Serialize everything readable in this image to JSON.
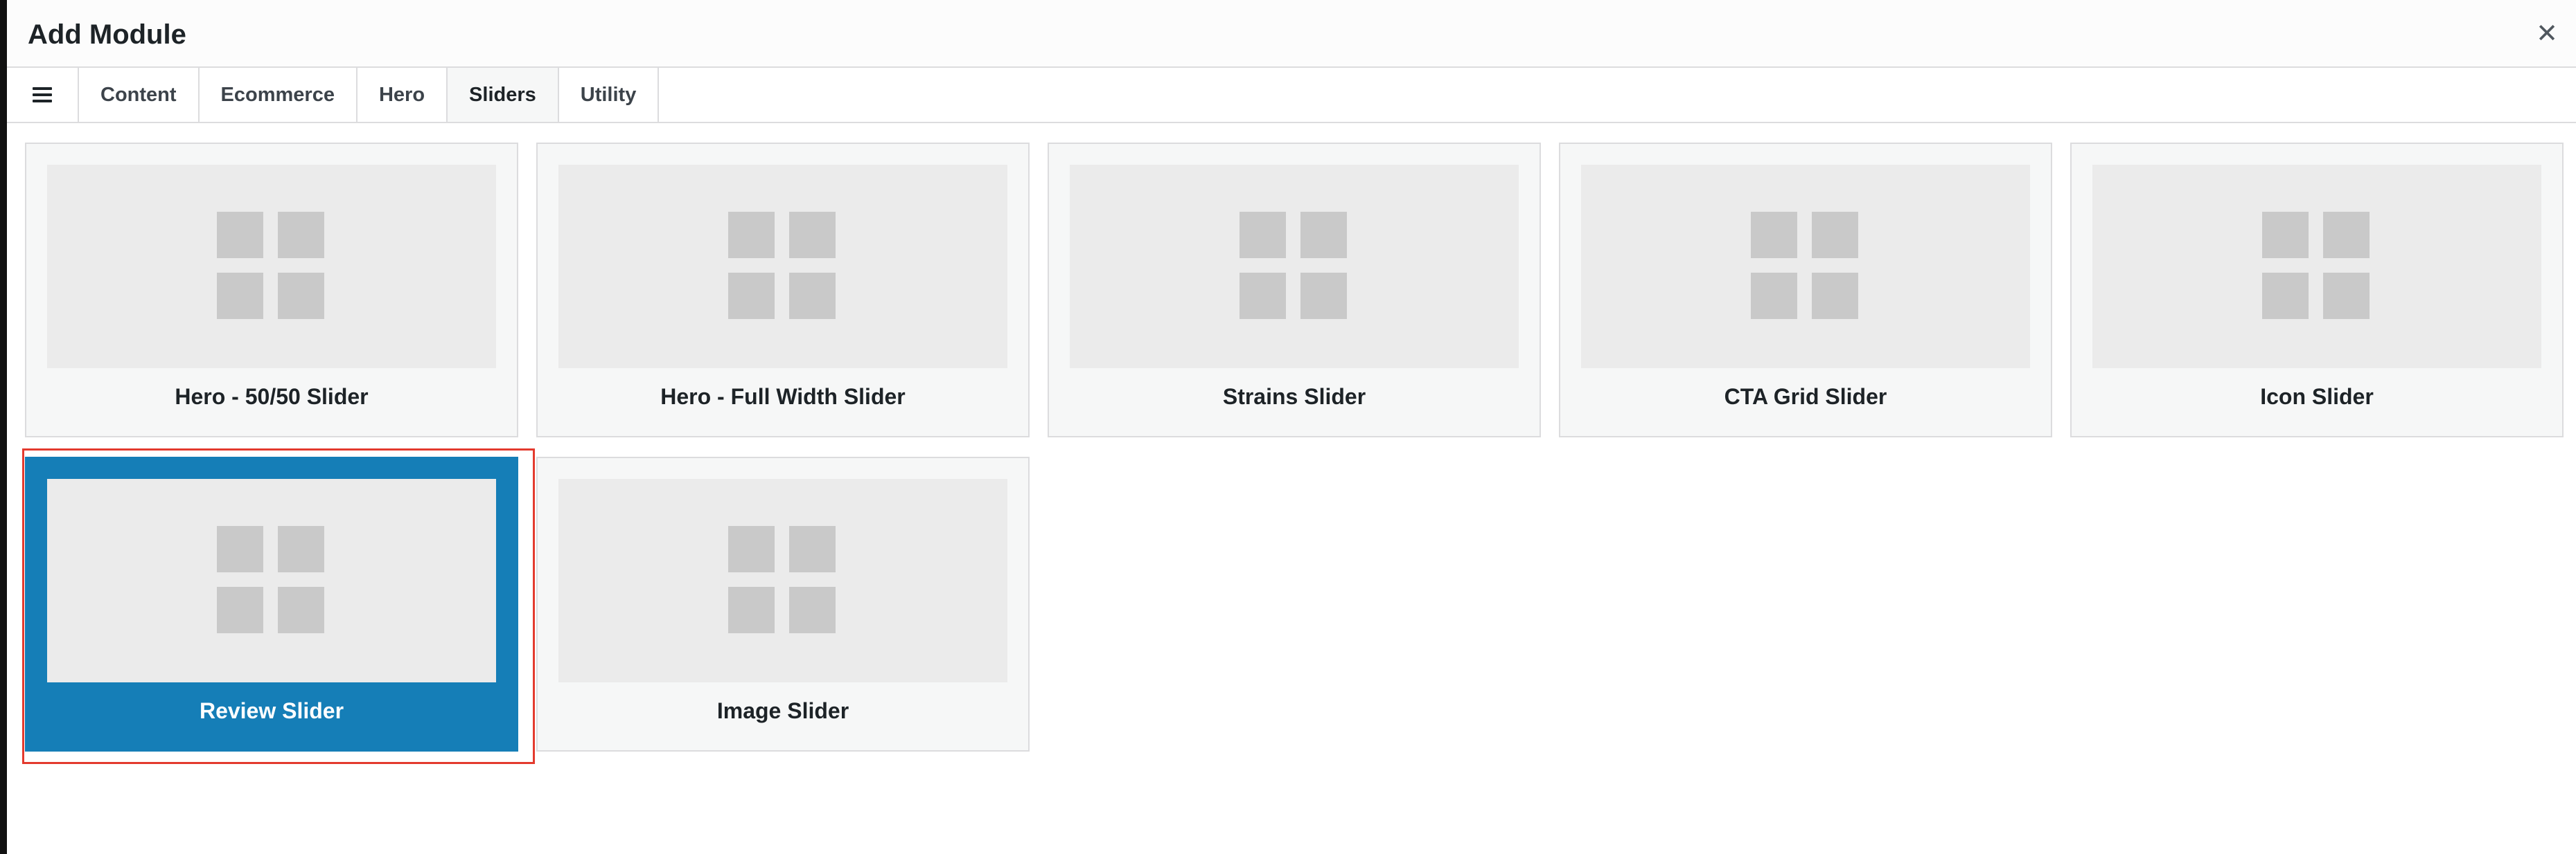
{
  "modal": {
    "title": "Add Module",
    "close_symbol": "✕"
  },
  "tabs": [
    {
      "label": "Content",
      "active": false
    },
    {
      "label": "Ecommerce",
      "active": false
    },
    {
      "label": "Hero",
      "active": false
    },
    {
      "label": "Sliders",
      "active": true
    },
    {
      "label": "Utility",
      "active": false
    }
  ],
  "modules": [
    {
      "label": "Hero - 50/50 Slider",
      "selected": false
    },
    {
      "label": "Hero - Full Width Slider",
      "selected": false
    },
    {
      "label": "Strains Slider",
      "selected": false
    },
    {
      "label": "CTA Grid Slider",
      "selected": false
    },
    {
      "label": "Icon Slider",
      "selected": false
    },
    {
      "label": "Review Slider",
      "selected": true
    },
    {
      "label": "Image Slider",
      "selected": false
    }
  ],
  "icons": {
    "menu": "hamburger-menu-icon",
    "close": "close-icon",
    "thumbnail": "grid-placeholder-icon"
  },
  "colors": {
    "selected_card": "#157eb7",
    "selection_outline": "#e33a2e",
    "card_background": "#f6f7f7",
    "placeholder": "#c9c9c9"
  }
}
